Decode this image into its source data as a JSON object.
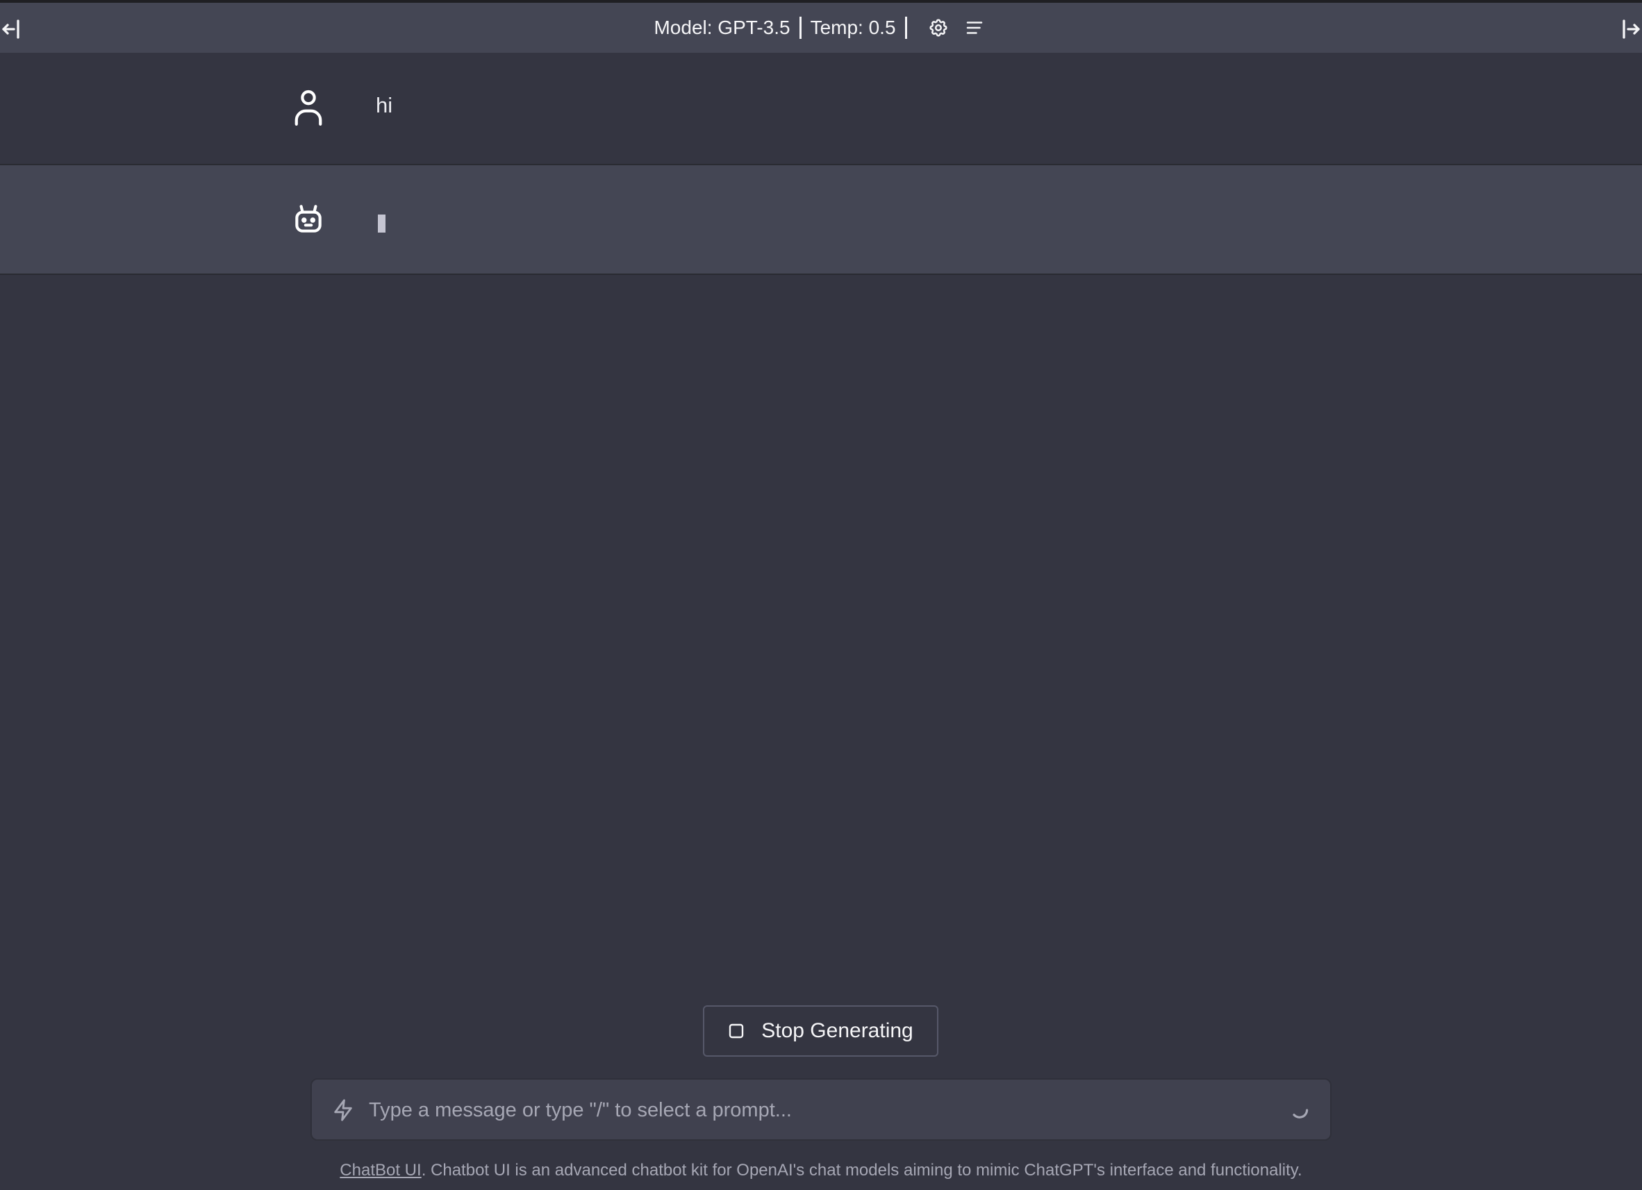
{
  "header": {
    "model_label": "Model: GPT-3.5",
    "temp_label": "Temp: 0.5",
    "icons": [
      "settings-icon",
      "clear-conversation-icon"
    ]
  },
  "sidebar_toggles": {
    "left_icon": "arrow-bar-left-icon",
    "right_icon": "arrow-bar-right-icon"
  },
  "messages": [
    {
      "role": "user",
      "avatar_icon": "user-icon",
      "text": "hi"
    },
    {
      "role": "assistant",
      "avatar_icon": "robot-icon",
      "text": ""
    }
  ],
  "stop_button": {
    "label": "Stop Generating",
    "icon": "stop-square-icon"
  },
  "input": {
    "placeholder": "Type a message or type \"/\" to select a prompt...",
    "value": "",
    "left_icon": "bolt-icon",
    "right_icon": "loading-spinner-icon"
  },
  "footer": {
    "link_text": "ChatBot UI",
    "text": ". Chatbot UI is an advanced chatbot kit for OpenAI's chat models aiming to mimic ChatGPT's interface and functionality."
  },
  "colors": {
    "background": "#343541",
    "header_bg": "#444654",
    "assistant_row_bg": "#444654",
    "input_bg": "#40414f"
  }
}
